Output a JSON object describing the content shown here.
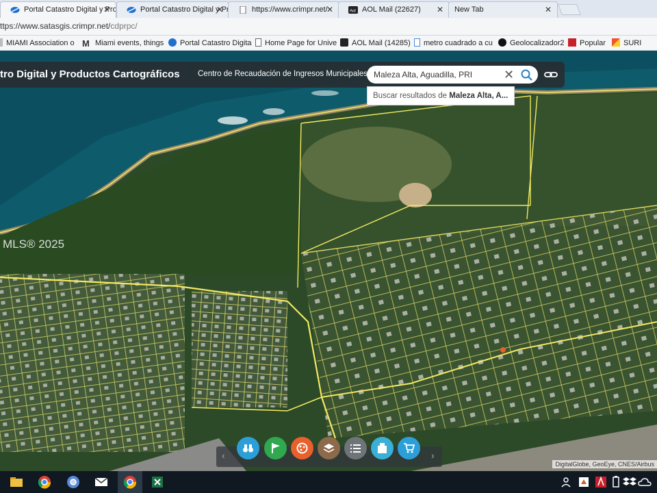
{
  "browser": {
    "tabs": [
      {
        "label": "Portal Catastro Digital y Pro",
        "active": true
      },
      {
        "label": "Portal Catastro Digital y Pro",
        "active": false
      },
      {
        "label": "https://www.crimpr.net/",
        "active": false
      },
      {
        "label": "AOL Mail (22627)",
        "active": false
      },
      {
        "label": "New Tab",
        "active": false
      }
    ],
    "url_prefix": "ttps://www.satasgis.crimpr.net/",
    "url_path": "cdprpc/",
    "bookmarks": [
      {
        "label": "MIAMI Association o"
      },
      {
        "label": "Miami events, things"
      },
      {
        "label": "Portal Catastro Digita"
      },
      {
        "label": "Home Page for Unive"
      },
      {
        "label": "AOL Mail (14285)"
      },
      {
        "label": "metro cuadrado a cu"
      },
      {
        "label": "Geolocalizador2"
      },
      {
        "label": "Popular"
      },
      {
        "label": "SURI"
      }
    ]
  },
  "app": {
    "title": "tro Digital y Productos Cartográficos",
    "subtitle": "Centro de Recaudación de Ingresos Municipales",
    "search": {
      "value": "Maleza Alta, Aguadilla, PRI",
      "suggestion_prefix": "Buscar resultados de ",
      "suggestion_bold": "Maleza Alta, A..."
    }
  },
  "map": {
    "watermark": "MLS® 2025",
    "attribution": "DigitalGlobe, GeoEye, CNES/Airbus"
  },
  "toolbar_tools": [
    {
      "name": "binoculars-icon",
      "color": "#2c9fd9"
    },
    {
      "name": "flag-icon",
      "color": "#2fa84f"
    },
    {
      "name": "measure-icon",
      "color": "#e8602c"
    },
    {
      "name": "layers-icon",
      "color": "#8c6a4a"
    },
    {
      "name": "list-icon",
      "color": "#6f7478"
    },
    {
      "name": "building-icon",
      "color": "#3ab0d6"
    },
    {
      "name": "cart-icon",
      "color": "#2c9fd9"
    }
  ],
  "colors": {
    "parcel_line": "#f3ea63",
    "ocean": "#0e5b6b",
    "vegetation": "#35502c"
  }
}
